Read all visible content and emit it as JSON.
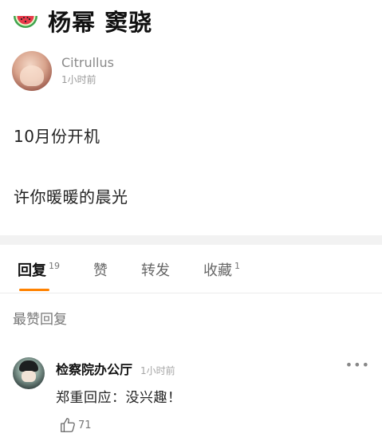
{
  "post": {
    "title": "杨幂 窦骁",
    "author": {
      "name": "Citrullus",
      "time": "1小时前"
    },
    "lines": [
      "10月份开机",
      "许你暖暖的晨光"
    ]
  },
  "tabs": [
    {
      "label": "回复",
      "count": "19"
    },
    {
      "label": "赞",
      "count": ""
    },
    {
      "label": "转发",
      "count": ""
    },
    {
      "label": "收藏",
      "count": "1"
    }
  ],
  "colors": {
    "accent": "#ff8200",
    "band": "#f2f2f2"
  },
  "section_heading": "最赞回复",
  "comment": {
    "name": "检察院办公厅",
    "time": "1小时前",
    "text": "郑重回应：没兴趣！",
    "more": "•••",
    "likes": "71"
  },
  "icons": {
    "title": "watermelon-icon",
    "like": "thumbs-up-icon",
    "more": "more-options-icon"
  }
}
